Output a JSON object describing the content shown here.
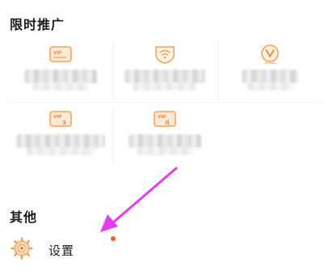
{
  "sections": {
    "promo_title": "限时推广",
    "other_title": "其他"
  },
  "promo_items": [
    {
      "icon": "vip-card-icon",
      "label": ""
    },
    {
      "icon": "wifi-shield-icon",
      "label": ""
    },
    {
      "icon": "v-badge-icon",
      "label": ""
    },
    {
      "icon": "vip-card-3-icon",
      "label": ""
    },
    {
      "icon": "vip-card-month-icon",
      "label": ""
    }
  ],
  "settings": {
    "label": "设置",
    "icon": "gear-icon",
    "has_notification_dot": true
  },
  "annotation": {
    "arrow_color": "#e33df0"
  },
  "colors": {
    "accent_orange": "#f7a055",
    "notification_red": "#ff5a2a"
  }
}
